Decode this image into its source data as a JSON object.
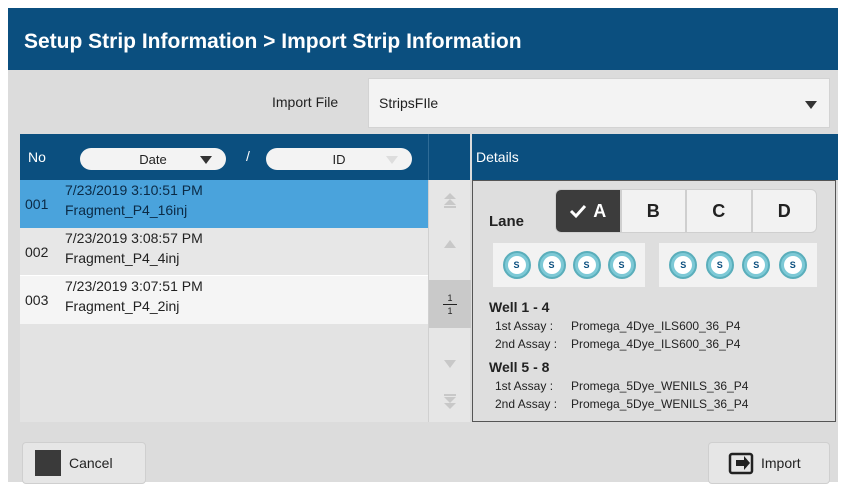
{
  "title": "Setup Strip Information > Import Strip Information",
  "import": {
    "label": "Import File",
    "value": "StripsFIle"
  },
  "list": {
    "col_no": "No",
    "col_date": "Date",
    "slash": "/",
    "col_id": "ID",
    "rows": [
      {
        "no": "001",
        "date": "7/23/2019 3:10:51 PM",
        "id": "Fragment_P4_16inj",
        "selected": true
      },
      {
        "no": "002",
        "date": "7/23/2019 3:08:57 PM",
        "id": "Fragment_P4_4inj",
        "selected": false
      },
      {
        "no": "003",
        "date": "7/23/2019 3:07:51 PM",
        "id": "Fragment_P4_2inj",
        "selected": false
      }
    ],
    "page_current": "1",
    "page_total": "1"
  },
  "details": {
    "header": "Details",
    "lane_label": "Lane",
    "lanes": [
      "A",
      "B",
      "C",
      "D"
    ],
    "active_lane": "A",
    "well_marker": "S",
    "group1": {
      "title": "Well 1 - 4",
      "assay1_label": "1st Assay :",
      "assay1_value": "Promega_4Dye_ILS600_36_P4",
      "assay2_label": "2nd Assay :",
      "assay2_value": "Promega_4Dye_ILS600_36_P4"
    },
    "group2": {
      "title": "Well 5 - 8",
      "assay1_label": "1st Assay :",
      "assay1_value": "Promega_5Dye_WENILS_36_P4",
      "assay2_label": "2nd Assay :",
      "assay2_value": "Promega_5Dye_WENILS_36_P4"
    }
  },
  "buttons": {
    "cancel": "Cancel",
    "import": "Import"
  },
  "colors": {
    "header_blue": "#0b4f7f",
    "selected_row": "#4aa3dc",
    "well_teal": "#7dc9d6"
  }
}
